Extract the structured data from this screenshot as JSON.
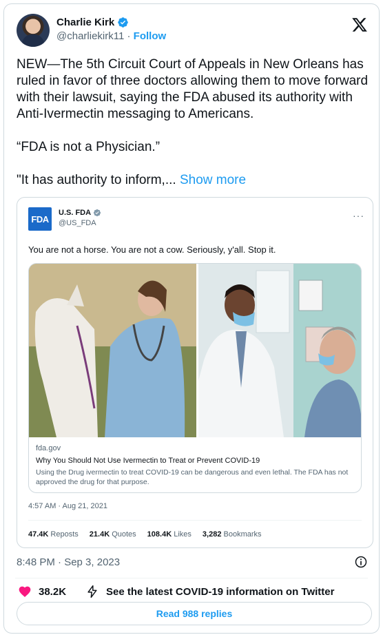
{
  "author": {
    "name": "Charlie Kirk",
    "handle": "@charliekirk11",
    "separator": "·",
    "follow_label": "Follow",
    "verified_color": "#1d9bf0"
  },
  "tweet": {
    "paragraphs": [
      "NEW—The 5th Circuit Court of Appeals in New Orleans has ruled in favor of three doctors allowing them to move forward with their lawsuit, saying the FDA abused its authority with Anti-Ivermectin messaging to Americans.",
      "“FDA is not a Physician.”"
    ],
    "truncated_line": "\"It has authority to inform,...",
    "show_more_label": "Show more",
    "timestamp": "8:48 PM · Sep 3, 2023"
  },
  "quoted": {
    "logo_text": "FDA",
    "name": "U.S. FDA",
    "handle": "@US_FDA",
    "more_label": "···",
    "text": "You are not a horse. You are not a cow. Seriously, y'all. Stop it.",
    "card": {
      "domain": "fda.gov",
      "title": "Why You Should Not Use Ivermectin to Treat or Prevent COVID-19",
      "description": "Using the Drug ivermectin to treat COVID-19 can be dangerous and even lethal. The FDA has not approved the drug for that purpose."
    },
    "timestamp": "4:57 AM · Aug 21, 2021",
    "stats": [
      {
        "value": "47.4K",
        "label": "Reposts"
      },
      {
        "value": "21.4K",
        "label": "Quotes"
      },
      {
        "value": "108.4K",
        "label": "Likes"
      },
      {
        "value": "3,282",
        "label": "Bookmarks"
      }
    ]
  },
  "actions": {
    "like_count": "38.2K",
    "covid_label": "See the latest COVID-19 information on Twitter",
    "like_color": "#f91880"
  },
  "replies_label": "Read 988 replies",
  "colors": {
    "accent": "#1d9bf0",
    "secondary_text": "#536471",
    "border": "#cfd9de",
    "fda_blue": "#1b6ac9"
  }
}
